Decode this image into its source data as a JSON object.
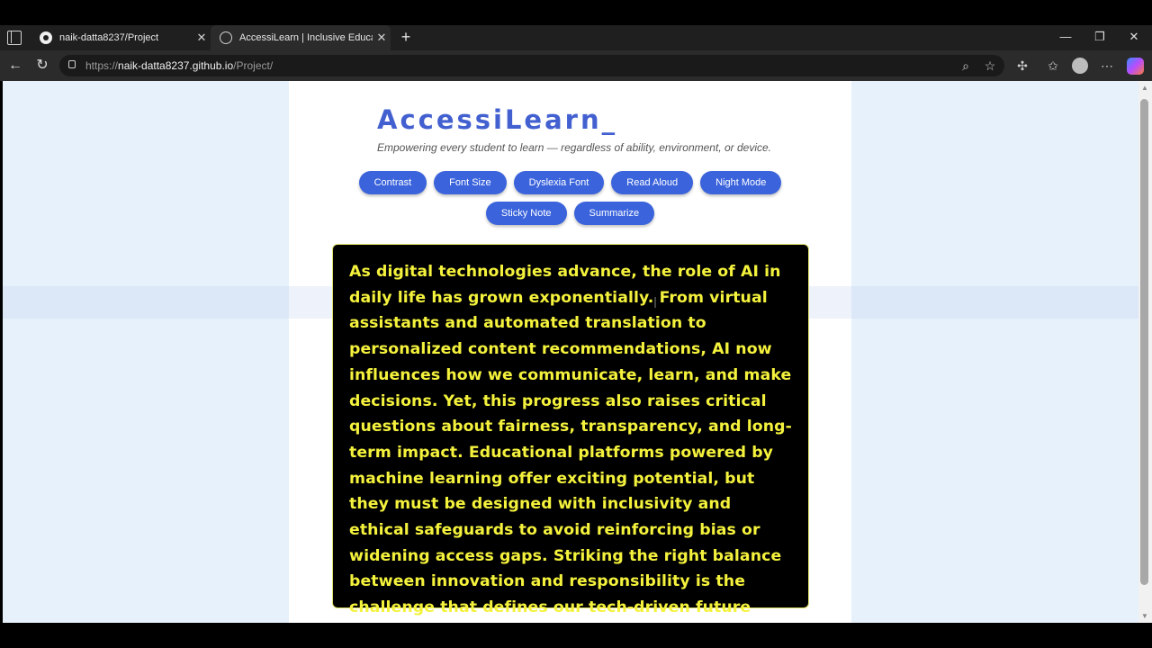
{
  "browser": {
    "tabs": [
      {
        "label": "naik-datta8237/Project",
        "icon": "github-icon"
      },
      {
        "label": "AccessiLearn | Inclusive Education",
        "icon": "globe-icon"
      }
    ],
    "new_tab": "+",
    "url_scheme": "https://",
    "url_host": "naik-datta8237.github.io",
    "url_path": "/Project/",
    "window_minimize": "—",
    "window_restore": "❐",
    "window_close": "✕"
  },
  "app": {
    "title": "AccessiLearn_",
    "tagline": "Empowering every student to learn — regardless of ability, environment, or device.",
    "tools": [
      "Contrast",
      "Font Size",
      "Dyslexia Font",
      "Read Aloud",
      "Night Mode",
      "Sticky Note",
      "Summarize"
    ],
    "reader_text": "As digital technologies advance, the role of AI in daily life has grown exponentially. From virtual assistants and automated translation to personalized content recommendations, AI now influences how we communicate, learn, and make decisions. Yet, this progress also raises critical questions about fairness, transparency, and long-term impact. Educational platforms powered by machine learning offer exciting potential, but they must be designed with inclusivity and ethical safeguards to avoid reinforcing bias or widening access gaps. Striking the right balance between innovation and responsibility is the challenge that defines our tech-driven future"
  },
  "colors": {
    "accent": "#3a63dc",
    "title": "#4360d0",
    "reader_bg": "#000000",
    "reader_text": "#f4f23c",
    "page_bg": "#e7f1fb"
  }
}
